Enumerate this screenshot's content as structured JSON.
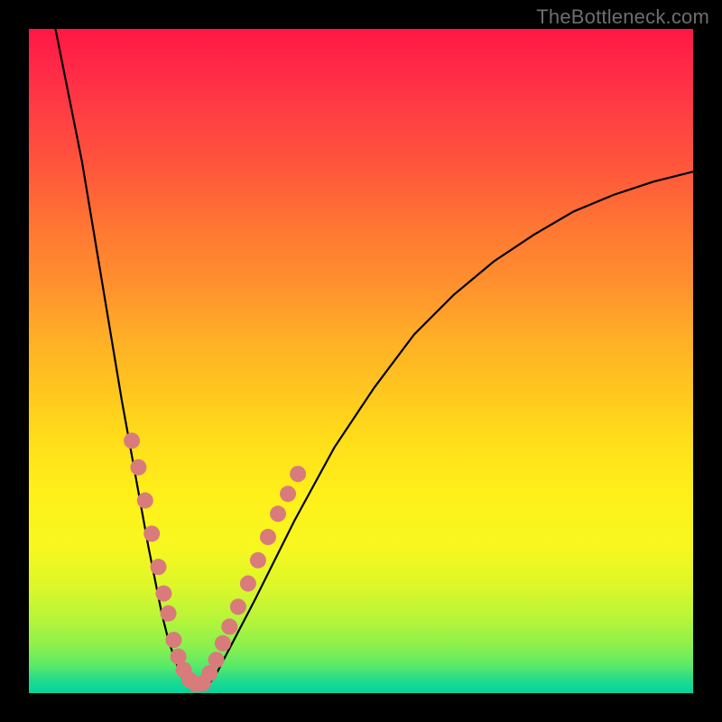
{
  "watermark": "TheBottleneck.com",
  "chart_data": {
    "type": "line",
    "title": "",
    "xlabel": "",
    "ylabel": "",
    "xlim": [
      0,
      100
    ],
    "ylim": [
      0,
      100
    ],
    "grid": false,
    "note": "Axes have no visible tick labels; x/y expressed as 0–100 percentage of plot width/height, y=0 at bottom.",
    "series": [
      {
        "name": "curve",
        "x": [
          4,
          6,
          8,
          10,
          12,
          14,
          16,
          18,
          20,
          21,
          22,
          23,
          24,
          25,
          26,
          27,
          28,
          34,
          40,
          46,
          52,
          58,
          64,
          70,
          76,
          82,
          88,
          94,
          100
        ],
        "y": [
          100,
          90,
          80,
          68,
          56,
          44,
          33,
          22,
          12,
          8,
          5,
          2.5,
          1.3,
          1,
          1,
          1.3,
          2.5,
          14,
          26,
          37,
          46,
          54,
          60,
          65,
          69,
          72.5,
          75,
          77,
          78.5
        ]
      }
    ],
    "markers": {
      "name": "dots",
      "note": "salmon-colored circular markers clustered on lower portion of both arms of the V",
      "points": [
        {
          "x": 15.5,
          "y": 38
        },
        {
          "x": 16.5,
          "y": 34
        },
        {
          "x": 17.5,
          "y": 29
        },
        {
          "x": 18.5,
          "y": 24
        },
        {
          "x": 19.5,
          "y": 19
        },
        {
          "x": 20.3,
          "y": 15
        },
        {
          "x": 21.0,
          "y": 12
        },
        {
          "x": 21.8,
          "y": 8
        },
        {
          "x": 22.5,
          "y": 5.5
        },
        {
          "x": 23.3,
          "y": 3.5
        },
        {
          "x": 24.2,
          "y": 2
        },
        {
          "x": 25.2,
          "y": 1.3
        },
        {
          "x": 26.2,
          "y": 1.5
        },
        {
          "x": 27.2,
          "y": 3
        },
        {
          "x": 28.2,
          "y": 5
        },
        {
          "x": 29.2,
          "y": 7.5
        },
        {
          "x": 30.2,
          "y": 10
        },
        {
          "x": 31.5,
          "y": 13
        },
        {
          "x": 33.0,
          "y": 16.5
        },
        {
          "x": 34.5,
          "y": 20
        },
        {
          "x": 36.0,
          "y": 23.5
        },
        {
          "x": 37.5,
          "y": 27
        },
        {
          "x": 39.0,
          "y": 30
        },
        {
          "x": 40.5,
          "y": 33
        }
      ]
    },
    "colors": {
      "curve": "#000000",
      "markers": "#d97b7b",
      "background_top": "#ff1744",
      "background_bottom": "#00d49e"
    }
  }
}
